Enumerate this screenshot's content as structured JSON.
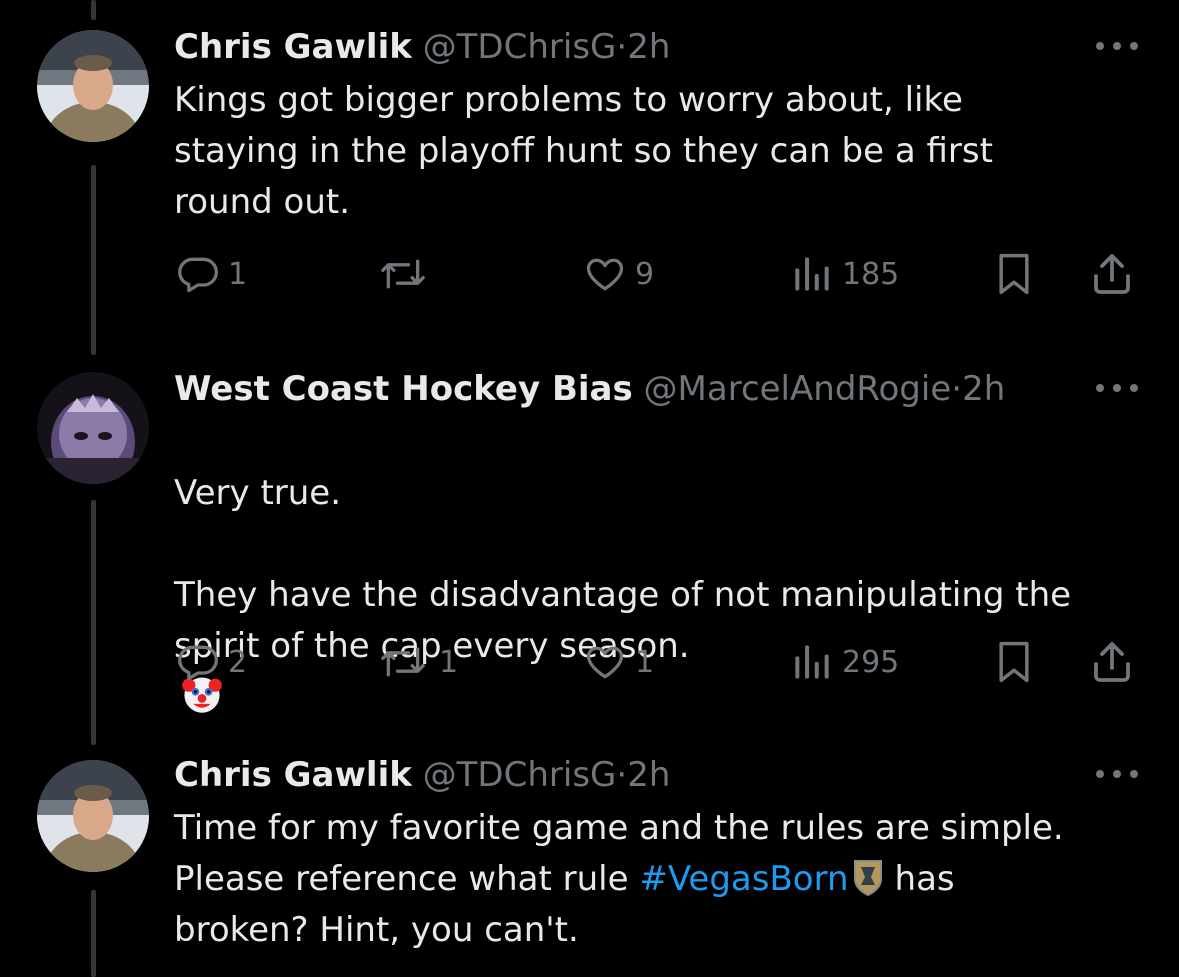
{
  "tweets": [
    {
      "name": "Chris Gawlik",
      "handle": "@TDChrisG",
      "dot": "·",
      "time": "2h",
      "text": "Kings got bigger problems to worry about, like\nstaying in the playoff hunt so they can be a first\nround out.",
      "replies": "1",
      "retweets": "",
      "likes": "9",
      "views": "185"
    },
    {
      "name": "West Coast Hockey Bias",
      "handle": "@MarcelAndRogie",
      "dot": "·",
      "time": "2h",
      "text": "Very true.\n\nThey have the disadvantage of not manipulating the\nspirit of the cap every season.",
      "emoji": "clown-face-emoji",
      "replies": "2",
      "retweets": "1",
      "likes": "1",
      "views": "295"
    },
    {
      "name": "Chris Gawlik",
      "handle": "@TDChrisG",
      "dot": "·",
      "time": "2h",
      "text_line1": "Time for my favorite game and the rules are simple.",
      "text_line2_pre": "Please reference what rule ",
      "hashtag": "#VegasBorn",
      "hashtag_icon": "vegas-golden-knights-logo",
      "text_line2_post": "has",
      "text_line3": "broken? Hint, you can't."
    }
  ],
  "colors": {
    "background": "#000000",
    "text": "#e7e9ea",
    "muted": "#71767b",
    "link": "#1d9bf0",
    "thread": "#333639"
  }
}
